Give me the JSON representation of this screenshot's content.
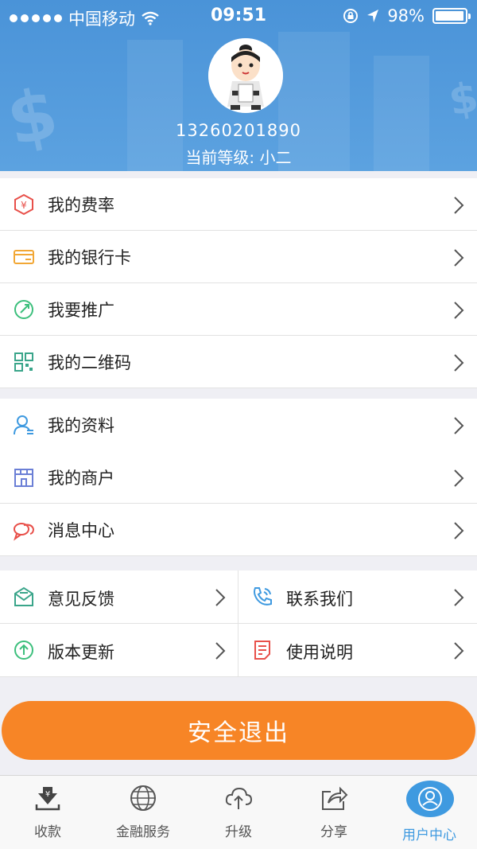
{
  "status_bar": {
    "carrier": "中国移动",
    "time": "09:51",
    "battery": "98%",
    "battery_level": 0.98
  },
  "profile": {
    "phone": "13260201890",
    "level_text": "当前等级: 小二"
  },
  "menu_group_1": [
    {
      "label": "我的费率",
      "icon": "rate-yen-icon"
    },
    {
      "label": "我的银行卡",
      "icon": "bank-card-icon"
    },
    {
      "label": "我要推广",
      "icon": "promote-icon"
    },
    {
      "label": "我的二维码",
      "icon": "qr-code-icon"
    }
  ],
  "menu_group_2": [
    {
      "label": "我的资料",
      "icon": "profile-icon"
    },
    {
      "label": "我的商户",
      "icon": "merchant-store-icon"
    },
    {
      "label": "消息中心",
      "icon": "message-icon"
    }
  ],
  "menu_grid": [
    {
      "label": "意见反馈",
      "icon": "feedback-icon"
    },
    {
      "label": "联系我们",
      "icon": "phone-contact-icon"
    },
    {
      "label": "版本更新",
      "icon": "update-icon"
    },
    {
      "label": "使用说明",
      "icon": "instructions-icon"
    }
  ],
  "logout_label": "安全退出",
  "tabs": [
    {
      "label": "收款",
      "icon": "receive-payment-icon"
    },
    {
      "label": "金融服务",
      "icon": "finance-globe-icon"
    },
    {
      "label": "升级",
      "icon": "upgrade-cloud-icon"
    },
    {
      "label": "分享",
      "icon": "share-icon"
    },
    {
      "label": "用户中心",
      "icon": "user-center-icon",
      "active": true
    }
  ],
  "colors": {
    "header_blue": "#4a93d8",
    "accent_orange": "#f78526",
    "tab_active": "#3f9ae0"
  }
}
